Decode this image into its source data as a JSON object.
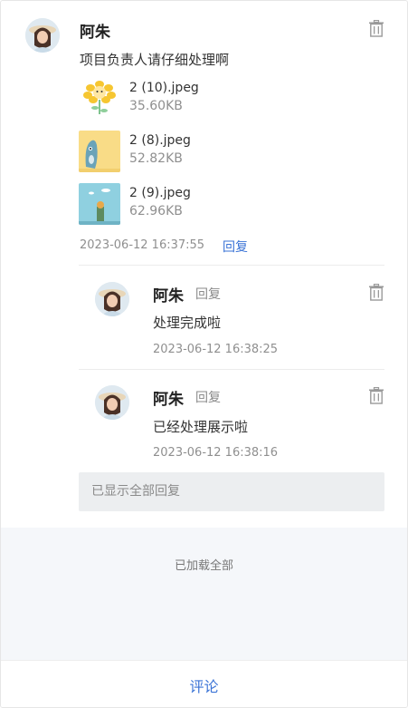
{
  "main_comment": {
    "author": "阿朱",
    "text": "项目负责人请仔细处理啊",
    "attachments": [
      {
        "name": "2 (10).jpeg",
        "size": "35.60KB",
        "thumb": "flower-image"
      },
      {
        "name": "2 (8).jpeg",
        "size": "52.82KB",
        "thumb": "cartoon-yellow-image"
      },
      {
        "name": "2 (9).jpeg",
        "size": "62.96KB",
        "thumb": "sky-cartoon-image"
      }
    ],
    "time": "2023-06-12 16:37:55",
    "reply_label": "回复"
  },
  "replies": [
    {
      "author": "阿朱",
      "reply_tag": "回复",
      "text": "处理完成啦",
      "time": "2023-06-12 16:38:25"
    },
    {
      "author": "阿朱",
      "reply_tag": "回复",
      "text": "已经处理展示啦",
      "time": "2023-06-12 16:38:16"
    }
  ],
  "all_replies_text": "已显示全部回复",
  "loaded_all_text": "已加载全部",
  "comment_button": "评论",
  "colors": {
    "link": "#3a73d6",
    "muted": "#8f8f8f",
    "panel": "#f5f7fa"
  },
  "icons": {
    "delete": "trash-icon",
    "avatar": "user-avatar"
  }
}
